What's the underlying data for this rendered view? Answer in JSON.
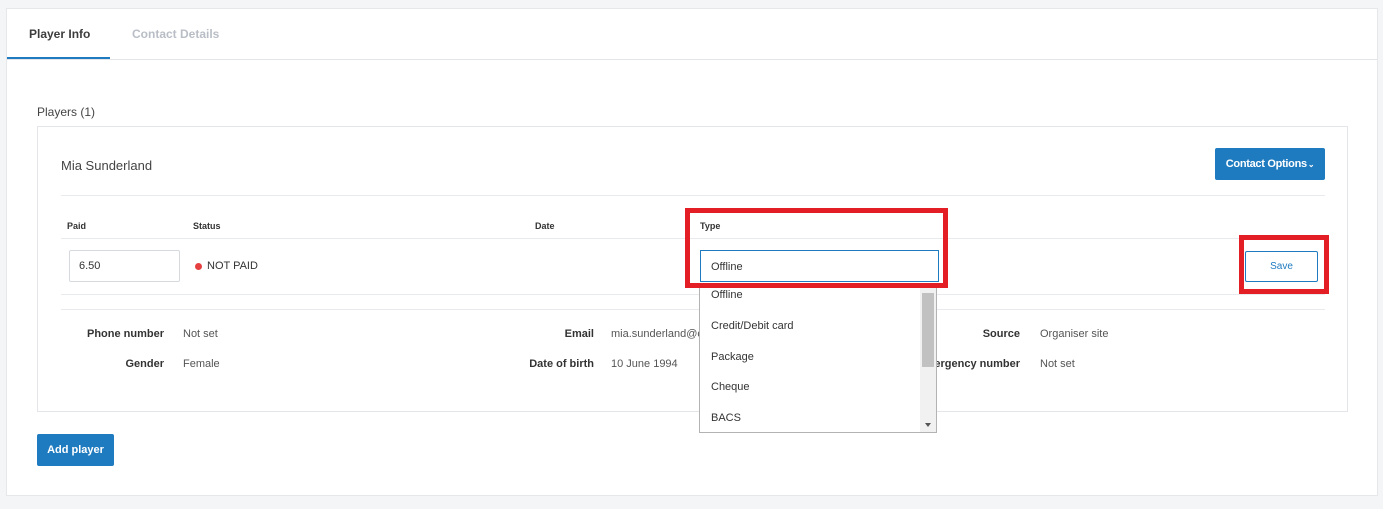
{
  "tabs": [
    {
      "label": "Player Info",
      "active": true
    },
    {
      "label": "Contact Details",
      "active": false
    }
  ],
  "section_title": "Players (1)",
  "player": {
    "name": "Mia Sunderland",
    "contact_options_label": "Contact Options",
    "columns": {
      "paid": "Paid",
      "status": "Status",
      "date": "Date",
      "type": "Type"
    },
    "paid_value": "6.50",
    "status_text": "NOT PAID",
    "status_color": "#e53f3f",
    "type_selected": "Offline",
    "save_label": "Save",
    "details": {
      "phone_label": "Phone number",
      "phone_value": "Not set",
      "gender_label": "Gender",
      "gender_value": "Female",
      "email_label": "Email",
      "email_value": "mia.sunderland@clu",
      "dob_label": "Date of birth",
      "dob_value": "10 June 1994",
      "source_label": "Source",
      "source_value": "Organiser site",
      "emergency_label": "mergency number",
      "emergency_value": "Not set"
    }
  },
  "type_options": [
    "Offline",
    "Credit/Debit card",
    "Package",
    "Cheque",
    "BACS"
  ],
  "add_player_label": "Add player",
  "colors": {
    "accent": "#1f7bbf",
    "highlight": "#e31e24"
  }
}
